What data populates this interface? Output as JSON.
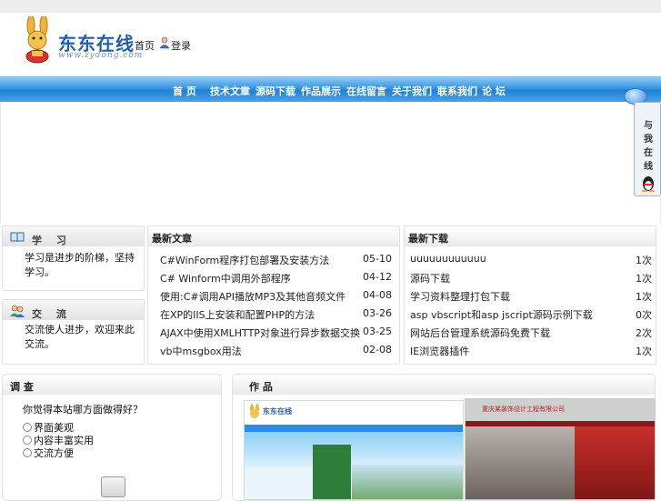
{
  "header": {
    "logo_text": "东东在线",
    "logo_url": "www.zydong.com",
    "link1": "首页",
    "link2": "登录"
  },
  "nav": {
    "items": [
      "首 页",
      "技术文章",
      "源码下载",
      "作品展示",
      "在线留言",
      "关于我们",
      "联系我们",
      "论 坛"
    ]
  },
  "float_qq": {
    "chars": [
      "与",
      "我",
      "在",
      "线"
    ]
  },
  "left": {
    "study": {
      "title": "学 习",
      "text": "学习是进步的阶梯，坚持学习。"
    },
    "exchange": {
      "title": "交 流",
      "text": "交流使人进步，欢迎来此交流。"
    }
  },
  "articles": {
    "title": "最新文章",
    "rows": [
      {
        "title": "C#WinForm程序打包部署及安装方法",
        "date": "05-10"
      },
      {
        "title": "C# Winform中调用外部程序",
        "date": "04-12"
      },
      {
        "title": "使用:C#调用API播放MP3及其他音频文件",
        "date": "04-08"
      },
      {
        "title": "在XP的IIS上安装和配置PHP的方法",
        "date": "03-26"
      },
      {
        "title": "AJAX中使用XMLHTTP对象进行异步数据交换",
        "date": "03-25"
      },
      {
        "title": "vb中msgbox用法",
        "date": "02-08"
      }
    ]
  },
  "downloads": {
    "title": "最新下载",
    "rows": [
      {
        "title": "uuuuuuuuuuuu",
        "count": "1次"
      },
      {
        "title": "源码下载",
        "count": "1次"
      },
      {
        "title": "学习资料整理打包下载",
        "count": "1次"
      },
      {
        "title": "asp vbscript和asp jscript源码示例下载",
        "count": "0次"
      },
      {
        "title": "网站后台管理系统源码免费下载",
        "count": "2次"
      },
      {
        "title": "IE浏览器插件",
        "count": "1次"
      }
    ]
  },
  "vote": {
    "title": "调 查",
    "question": "你觉得本站哪方面做得好？",
    "options": [
      "界面美观",
      "内容丰富实用",
      "交流方便"
    ]
  },
  "works": {
    "title": "作 品",
    "shot1_logo": "东东在线",
    "shot2_caption": "重庆某装饰设计工程有限公司"
  },
  "colors": {
    "nav_blue": "#1f7fd4",
    "logo_blue": "#1f5fa8"
  }
}
